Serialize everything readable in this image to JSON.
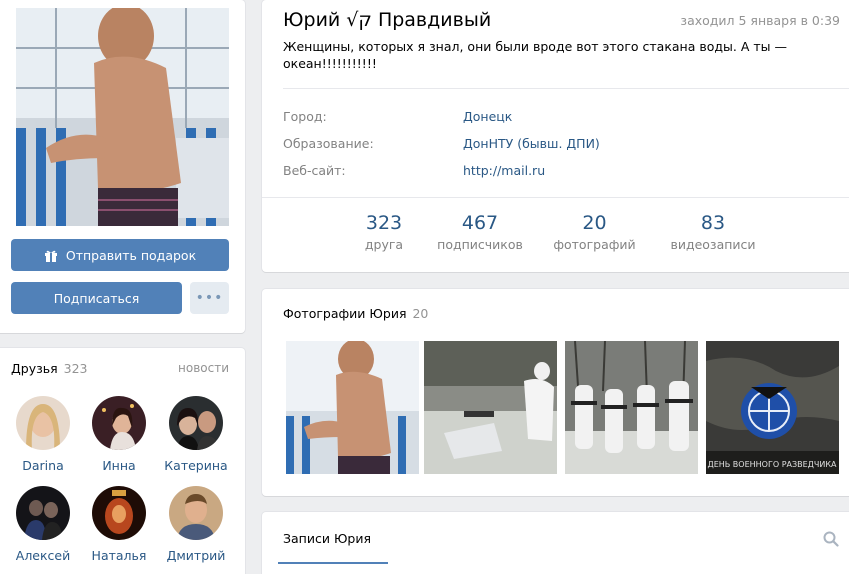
{
  "profile": {
    "name": "Юрий √ק Правдивый",
    "last_seen": "заходил 5 января в 0:39",
    "status": "Женщины, которых я знал, они были вроде вот этого стакана воды. А ты — океан!!!!!!!!!!!",
    "info": [
      {
        "label": "Город:",
        "value": "Донецк"
      },
      {
        "label": "Образование:",
        "value": "ДонНТУ (бывш. ДПИ)"
      },
      {
        "label": "Веб-сайт:",
        "value": "http://mail.ru"
      }
    ],
    "counters": [
      {
        "num": "323",
        "label": "друга"
      },
      {
        "num": "467",
        "label": "подписчиков"
      },
      {
        "num": "20",
        "label": "фотографий"
      },
      {
        "num": "83",
        "label": "видеозаписи"
      }
    ]
  },
  "actions": {
    "gift_label": "Отправить подарок",
    "subscribe_label": "Подписаться",
    "more_label": "•••"
  },
  "friends": {
    "title": "Друзья",
    "count": "323",
    "news_label": "новости",
    "items": [
      {
        "name": "Darina"
      },
      {
        "name": "Инна"
      },
      {
        "name": "Катерина"
      },
      {
        "name": "Алексей"
      },
      {
        "name": "Наталья"
      },
      {
        "name": "Дмитрий"
      }
    ]
  },
  "photos": {
    "title": "Фотографии Юрия",
    "count": "20",
    "banner_text": "ДЕНЬ ВОЕННОГО РАЗВЕДЧИКА"
  },
  "wall": {
    "tab_label": "Записи Юрия"
  },
  "colors": {
    "accent": "#5181b8",
    "link": "#2a5885",
    "page_bg": "#edeef0"
  }
}
